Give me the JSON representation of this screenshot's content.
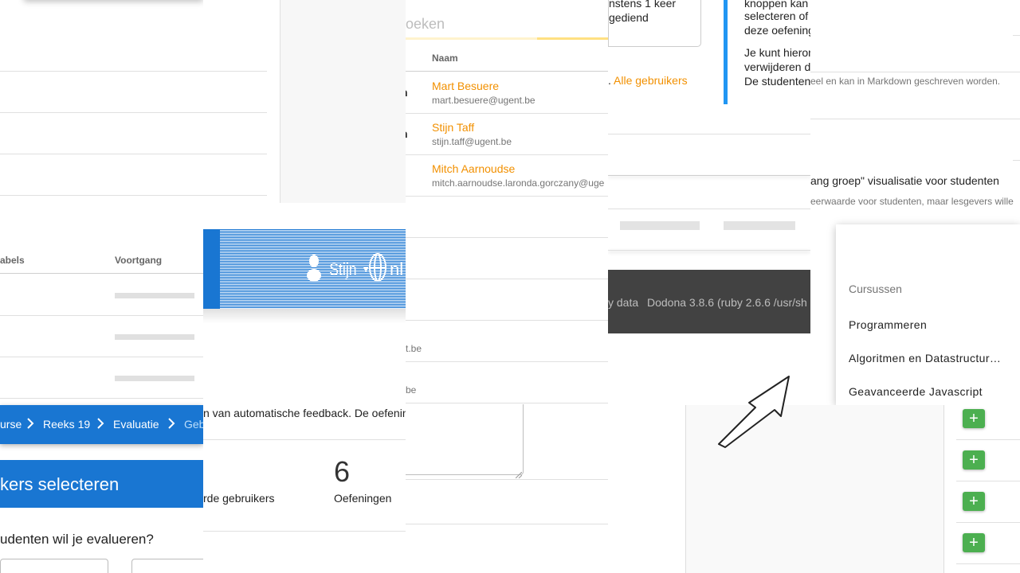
{
  "breadcrumb": {
    "items": [
      "urse",
      "Reeks 19",
      "Evaluatie",
      "Geb"
    ]
  },
  "evaluation": {
    "title": "kers selecteren",
    "question": "udenten wil je evalueren?",
    "table_headers": [
      "abels",
      "Voortgang"
    ]
  },
  "stats": {
    "users_label": "rde gebruikers",
    "exercises_count": "6",
    "exercises_label": "Oefeningen"
  },
  "feedback_text": "n van automatische feedback. De oefening",
  "search_placeholder": "oeken",
  "navbar": {
    "user": "Stijn",
    "language": "nl"
  },
  "users_table": {
    "header_name": "Naam",
    "left_fragment": "n",
    "rows": [
      {
        "name": "Mart Besuere",
        "email": "mart.besuere@ugent.be"
      },
      {
        "name": "Stijn Taff",
        "email": "stijn.taff@ugent.be"
      },
      {
        "name": "Mitch Aarnoudse",
        "email": "mitch.aarnoudse.laronda.gorczany@uge"
      }
    ],
    "email_fragments": [
      "t.be",
      "be"
    ]
  },
  "card_text": [
    "nstens 1 keer",
    "gediend"
  ],
  "users_link": {
    "prefix": ".",
    "label": "Alle gebruikers"
  },
  "footer": {
    "data_link": "y data",
    "version": "Dodona 3.8.6 (ruby 2.6.6 /usr/sh"
  },
  "info": {
    "lines": [
      "knoppen kan",
      "selecteren of",
      "deze oefening",
      "Je kunt hieron",
      "verwijderen d",
      "De studenten"
    ]
  },
  "description": {
    "markdown_note": "eel en kan in Markdown geschreven worden.",
    "progress_option": "ang groep\" visualisatie voor studenten",
    "progress_note": "eerwaarde voor studenten, maar lesgevers wille"
  },
  "courses_menu": {
    "header": "Cursussen",
    "items": [
      "Programmeren",
      "Algoritmen en Datastructur…",
      "Geavanceerde Javascript"
    ]
  },
  "add_buttons": [
    "+",
    "+",
    "+",
    "+"
  ],
  "colors": {
    "primary": "#1976d2",
    "accent_orange": "#f29000",
    "info_blue": "#2196f3",
    "success_green": "#4caf50",
    "footer_bg": "#424242"
  },
  "icons": [
    "user-icon",
    "globe-icon",
    "chevron-right-icon",
    "caret-down-icon",
    "arrow-icon",
    "plus-icon"
  ]
}
